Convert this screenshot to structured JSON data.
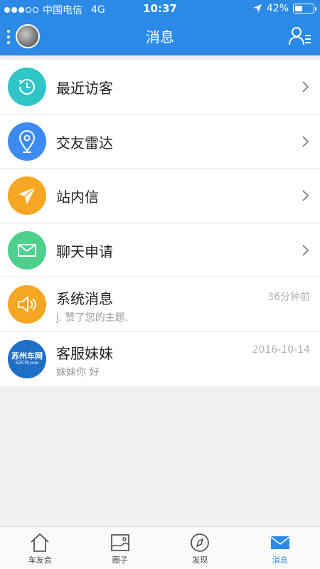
{
  "status_bar": {
    "carrier": "中国电信",
    "network": "4G",
    "time": "10:37",
    "battery_percent": "42%",
    "battery_level": 0.42
  },
  "nav": {
    "title": "消息"
  },
  "messages": [
    {
      "label": "最近访客",
      "icon": "clock-history-icon",
      "color": "#2fc5c7"
    },
    {
      "label": "交友雷达",
      "icon": "location-pin-icon",
      "color": "#3d8bf2"
    },
    {
      "label": "站内信",
      "icon": "paper-plane-icon",
      "color": "#f5a623"
    },
    {
      "label": "聊天申请",
      "icon": "envelope-icon",
      "color": "#4fcf8c"
    },
    {
      "label": "系统消息",
      "subtitle": "j. 赞了您的主题.",
      "time": "36分钟前",
      "icon": "speaker-icon",
      "color": "#f5a623"
    },
    {
      "label": "客服妹妹",
      "subtitle": "妹妹你 好",
      "time": "2016-10-14",
      "icon": "logo-avatar",
      "logo_text": "苏州车网",
      "logo_sub": "SZCW.com",
      "color": "#1f6fc7"
    }
  ],
  "tabbar": {
    "tabs": [
      {
        "label": "车友会",
        "icon": "house-icon",
        "active": false
      },
      {
        "label": "圈子",
        "icon": "image-icon",
        "active": false
      },
      {
        "label": "发现",
        "icon": "compass-icon",
        "active": false
      },
      {
        "label": "消息",
        "icon": "mail-icon",
        "active": true
      }
    ],
    "active_color": "#2a8ae6"
  }
}
